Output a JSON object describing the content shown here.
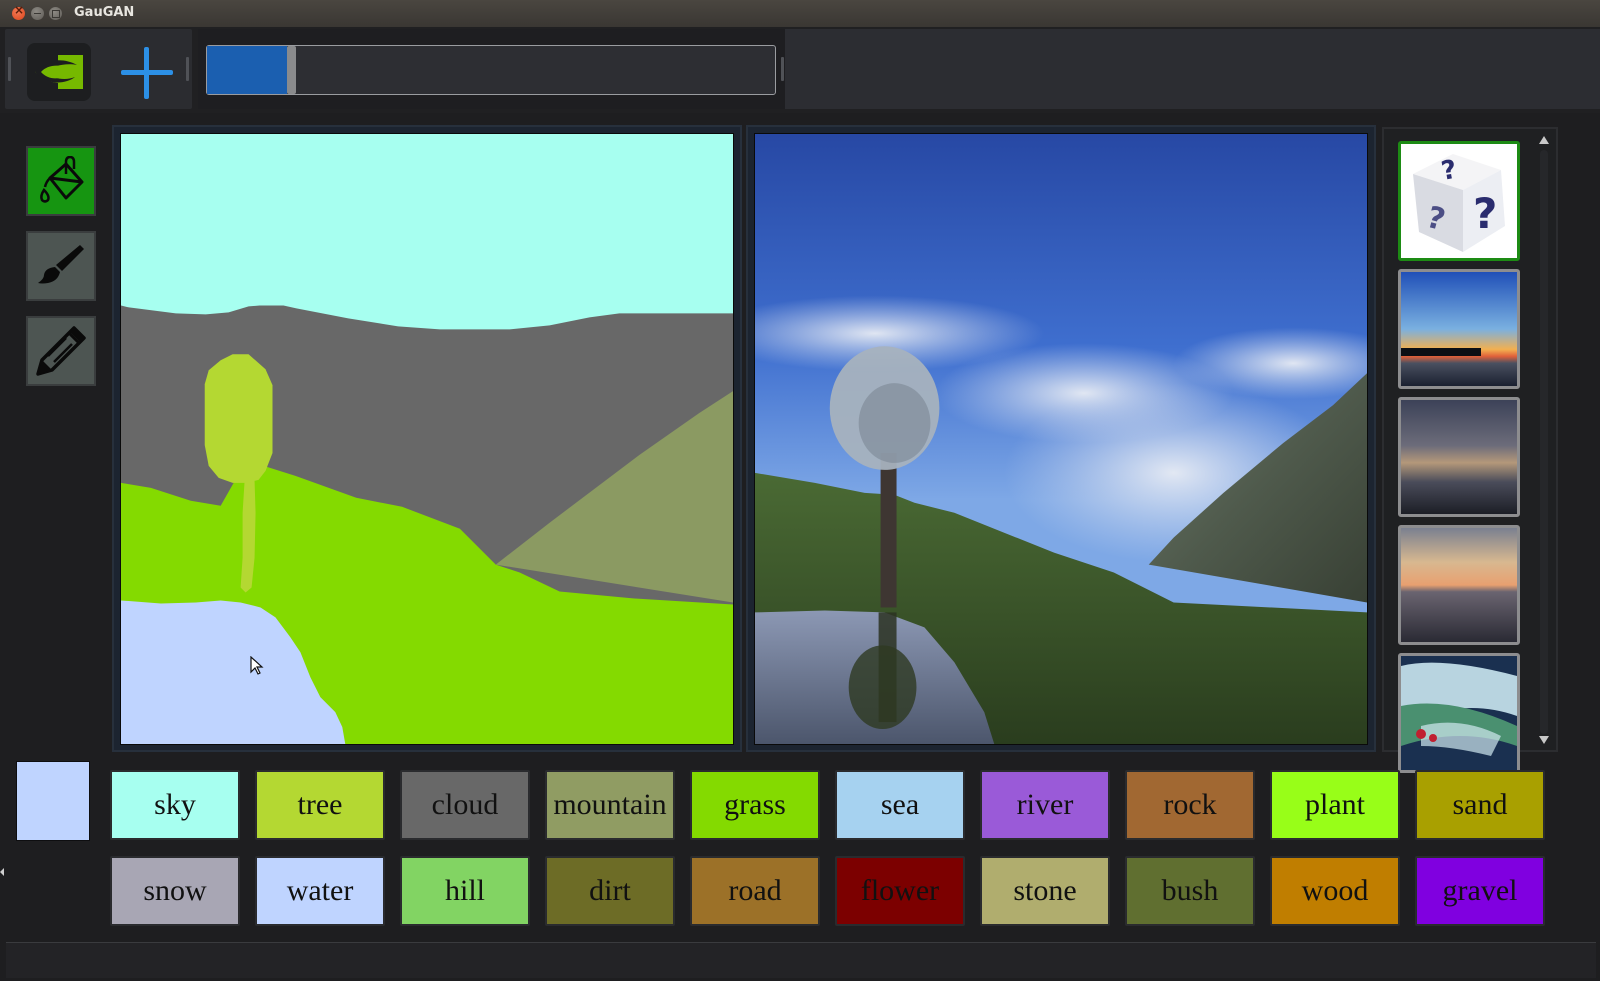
{
  "window": {
    "title": "GauGAN",
    "controls": [
      "close",
      "minimize",
      "maximize"
    ]
  },
  "toolbar": {
    "logo_icon": "nvidia-logo-icon",
    "add_icon": "plus-icon",
    "style_slider": {
      "value_fraction": 0.14,
      "fill_color": "#1b5fb0"
    }
  },
  "tools": [
    {
      "name": "fill",
      "icon": "paint-bucket-icon",
      "active": true
    },
    {
      "name": "brush",
      "icon": "paint-brush-icon",
      "active": false
    },
    {
      "name": "pencil",
      "icon": "pencil-icon",
      "active": false
    }
  ],
  "current_color": "#bfd4ff",
  "segmentation_map": {
    "regions": [
      {
        "label": "sky",
        "color": "#a7fff0"
      },
      {
        "label": "cloud",
        "color": "#686868"
      },
      {
        "label": "mountain",
        "color": "#8b9a62"
      },
      {
        "label": "grass",
        "color": "#84da00"
      },
      {
        "label": "tree",
        "color": "#b4d832"
      },
      {
        "label": "water",
        "color": "#bfd4ff"
      }
    ]
  },
  "style_gallery": {
    "items": [
      {
        "name": "random-style",
        "icon": "dice-icon",
        "selected": true
      },
      {
        "name": "sunset-lake",
        "selected": false
      },
      {
        "name": "cloudy-sea",
        "selected": false
      },
      {
        "name": "city-sunset",
        "selected": false
      },
      {
        "name": "painting",
        "selected": false
      }
    ]
  },
  "palette": {
    "row1": [
      {
        "label": "sky",
        "color": "#a7fff0"
      },
      {
        "label": "tree",
        "color": "#b4d832"
      },
      {
        "label": "cloud",
        "color": "#686868"
      },
      {
        "label": "mountain",
        "color": "#909c63"
      },
      {
        "label": "grass",
        "color": "#84da00"
      },
      {
        "label": "sea",
        "color": "#a6d2f0"
      },
      {
        "label": "river",
        "color": "#9a5ad8"
      },
      {
        "label": "rock",
        "color": "#a16832"
      },
      {
        "label": "plant",
        "color": "#98fe18"
      },
      {
        "label": "sand",
        "color": "#a9a000"
      }
    ],
    "row2": [
      {
        "label": "snow",
        "color": "#a8a6b4"
      },
      {
        "label": "water",
        "color": "#bfd4ff"
      },
      {
        "label": "hill",
        "color": "#82d463"
      },
      {
        "label": "dirt",
        "color": "#6d6c26"
      },
      {
        "label": "road",
        "color": "#9c7128"
      },
      {
        "label": "flower",
        "color": "#7c0000"
      },
      {
        "label": "stone",
        "color": "#b0ad6e"
      },
      {
        "label": "bush",
        "color": "#606f30"
      },
      {
        "label": "wood",
        "color": "#c07e00"
      },
      {
        "label": "gravel",
        "color": "#8000e0"
      }
    ]
  }
}
